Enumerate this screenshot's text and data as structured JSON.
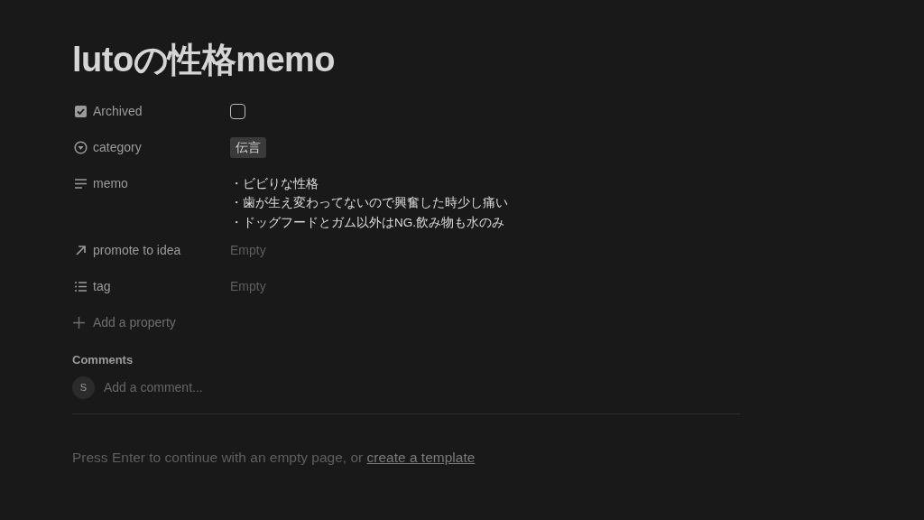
{
  "title": "lutoの性格memo",
  "properties": [
    {
      "kind": "checkbox",
      "label": "Archived",
      "checked": false
    },
    {
      "kind": "select",
      "label": "category",
      "value": "伝言"
    },
    {
      "kind": "text",
      "label": "memo",
      "lines": [
        "・ビビりな性格",
        "・歯が生え変わってないので興奮した時少し痛い",
        "・ドッグフードとガム以外はNG.飲み物も水のみ"
      ]
    },
    {
      "kind": "relation",
      "label": "promote to idea",
      "value": "Empty"
    },
    {
      "kind": "multi_select",
      "label": "tag",
      "value": "Empty"
    }
  ],
  "add_property": "Add a property",
  "comments": {
    "heading": "Comments",
    "avatar": "S",
    "placeholder": "Add a comment..."
  },
  "footer": {
    "text": "Press Enter to continue with an empty page, or ",
    "link": "create a template"
  }
}
